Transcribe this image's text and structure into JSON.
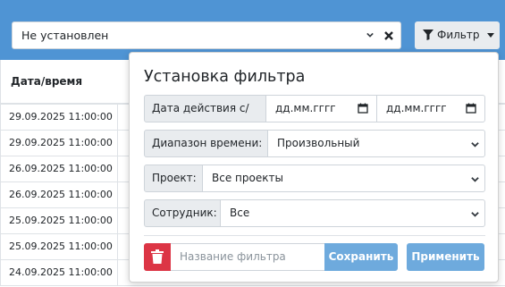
{
  "toolbar": {
    "select_value": "Не установлен",
    "filter_label": "Фильтр"
  },
  "table": {
    "header": "Дата/время",
    "rows": [
      "29.09.2025 11:00:00",
      "29.09.2025 11:00:00",
      "26.09.2025 11:00:00",
      "26.09.2025 11:00:00",
      "25.09.2025 11:00:00",
      "25.09.2025 11:00:00",
      "24.09.2025 11:00:00"
    ]
  },
  "filter_panel": {
    "title": "Установка фильтра",
    "date_label": "Дата действия с/по:",
    "date_from_placeholder": "дд.мм.гггг",
    "date_to_placeholder": "дд.мм.гггг",
    "time_range_label": "Диапазон времени:",
    "time_range_value": "Произвольный",
    "project_label": "Проект:",
    "project_value": "Все проекты",
    "employee_label": "Сотрудник:",
    "employee_value": "Все",
    "filter_name_placeholder": "Название фильтра",
    "save_label": "Сохранить",
    "apply_label": "Применить"
  },
  "colors": {
    "topbar": "#4f94d4",
    "primary_button": "#6eaadd",
    "danger": "#dc3545"
  }
}
